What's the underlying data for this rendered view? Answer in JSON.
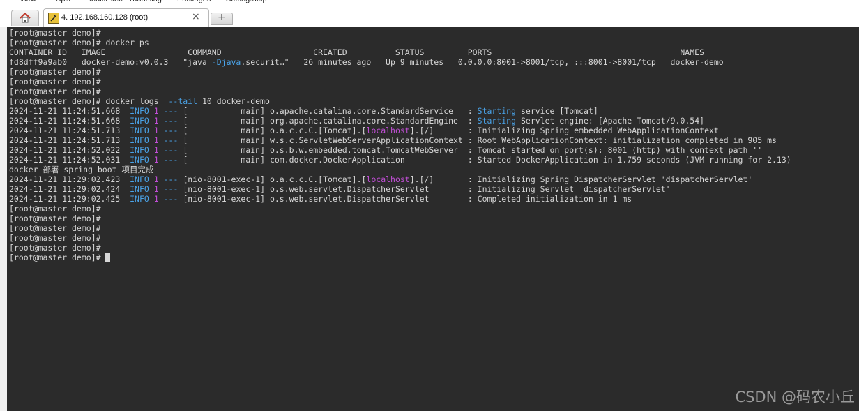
{
  "menu": {
    "items": [
      "View",
      "Split",
      "MultiExec",
      "Tunneling",
      "Packages",
      "Settings",
      "Help"
    ]
  },
  "tabs": {
    "home_icon": "home-icon",
    "active_label": "4. 192.168.160.128 (root)",
    "active_icon": "session-icon",
    "close_glyph": "×",
    "new_tab_glyph": "+"
  },
  "terminal": {
    "lines": [
      [
        {
          "t": "[root@master demo]#"
        }
      ],
      [
        {
          "t": "[root@master demo]# docker ps"
        }
      ],
      [
        {
          "t": "CONTAINER ID   IMAGE                 COMMAND                   CREATED          STATUS         PORTS                                       NAMES"
        }
      ],
      [
        {
          "t": "fd8dff9a9ab0   docker-demo:v0.0.3   \"java "
        },
        {
          "t": "-Djava",
          "c": "blue"
        },
        {
          "t": ".securit…\"   26 minutes ago   Up 9 minutes   0.0.0.0:8001->8001/tcp, :::8001->8001/tcp   docker-demo"
        }
      ],
      [
        {
          "t": "[root@master demo]#"
        }
      ],
      [
        {
          "t": "[root@master demo]#"
        }
      ],
      [
        {
          "t": "[root@master demo]#"
        }
      ],
      [
        {
          "t": "[root@master demo]# docker logs  "
        },
        {
          "t": "--tail",
          "c": "blue"
        },
        {
          "t": " 10 docker-demo"
        }
      ],
      [
        {
          "t": "2024-11-21 11:24:51.668  "
        },
        {
          "t": "INFO",
          "c": "blue"
        },
        {
          "t": " "
        },
        {
          "t": "1",
          "c": "pink"
        },
        {
          "t": " "
        },
        {
          "t": "---",
          "c": "blue"
        },
        {
          "t": " [           main] o.apache.catalina.core.StandardService   : "
        },
        {
          "t": "Starting",
          "c": "blue"
        },
        {
          "t": " service [Tomcat]"
        }
      ],
      [
        {
          "t": "2024-11-21 11:24:51.668  "
        },
        {
          "t": "INFO",
          "c": "blue"
        },
        {
          "t": " "
        },
        {
          "t": "1",
          "c": "pink"
        },
        {
          "t": " "
        },
        {
          "t": "---",
          "c": "blue"
        },
        {
          "t": " [           main] org.apache.catalina.core.StandardEngine  : "
        },
        {
          "t": "Starting",
          "c": "blue"
        },
        {
          "t": " Servlet engine: [Apache Tomcat/9.0.54]"
        }
      ],
      [
        {
          "t": "2024-11-21 11:24:51.713  "
        },
        {
          "t": "INFO",
          "c": "blue"
        },
        {
          "t": " "
        },
        {
          "t": "1",
          "c": "pink"
        },
        {
          "t": " "
        },
        {
          "t": "---",
          "c": "blue"
        },
        {
          "t": " [           main] o.a.c.c.C.[Tomcat].["
        },
        {
          "t": "localhost",
          "c": "pink"
        },
        {
          "t": "].[/]       : Initializing Spring embedded WebApplicationContext"
        }
      ],
      [
        {
          "t": "2024-11-21 11:24:51.713  "
        },
        {
          "t": "INFO",
          "c": "blue"
        },
        {
          "t": " "
        },
        {
          "t": "1",
          "c": "pink"
        },
        {
          "t": " "
        },
        {
          "t": "---",
          "c": "blue"
        },
        {
          "t": " [           main] w.s.c.ServletWebServerApplicationContext : Root WebApplicationContext: initialization completed in 905 ms"
        }
      ],
      [
        {
          "t": "2024-11-21 11:24:52.022  "
        },
        {
          "t": "INFO",
          "c": "blue"
        },
        {
          "t": " "
        },
        {
          "t": "1",
          "c": "pink"
        },
        {
          "t": " "
        },
        {
          "t": "---",
          "c": "blue"
        },
        {
          "t": " [           main] o.s.b.w.embedded.tomcat.TomcatWebServer  : Tomcat started on port(s): 8001 (http) with context path ''"
        }
      ],
      [
        {
          "t": "2024-11-21 11:24:52.031  "
        },
        {
          "t": "INFO",
          "c": "blue"
        },
        {
          "t": " "
        },
        {
          "t": "1",
          "c": "pink"
        },
        {
          "t": " "
        },
        {
          "t": "---",
          "c": "blue"
        },
        {
          "t": " [           main] com.docker.DockerApplication             : Started DockerApplication in 1.759 seconds (JVM running for 2.13)"
        }
      ],
      [
        {
          "t": "docker 部署 spring boot 项目完成"
        }
      ],
      [
        {
          "t": "2024-11-21 11:29:02.423  "
        },
        {
          "t": "INFO",
          "c": "blue"
        },
        {
          "t": " "
        },
        {
          "t": "1",
          "c": "pink"
        },
        {
          "t": " "
        },
        {
          "t": "---",
          "c": "blue"
        },
        {
          "t": " [nio-8001-exec-1] o.a.c.c.C.[Tomcat].["
        },
        {
          "t": "localhost",
          "c": "pink"
        },
        {
          "t": "].[/]       : Initializing Spring DispatcherServlet 'dispatcherServlet'"
        }
      ],
      [
        {
          "t": "2024-11-21 11:29:02.424  "
        },
        {
          "t": "INFO",
          "c": "blue"
        },
        {
          "t": " "
        },
        {
          "t": "1",
          "c": "pink"
        },
        {
          "t": " "
        },
        {
          "t": "---",
          "c": "blue"
        },
        {
          "t": " [nio-8001-exec-1] o.s.web.servlet.DispatcherServlet        : Initializing Servlet 'dispatcherServlet'"
        }
      ],
      [
        {
          "t": "2024-11-21 11:29:02.425  "
        },
        {
          "t": "INFO",
          "c": "blue"
        },
        {
          "t": " "
        },
        {
          "t": "1",
          "c": "pink"
        },
        {
          "t": " "
        },
        {
          "t": "---",
          "c": "blue"
        },
        {
          "t": " [nio-8001-exec-1] o.s.web.servlet.DispatcherServlet        : Completed initialization in 1 ms"
        }
      ],
      [
        {
          "t": "[root@master demo]#"
        }
      ],
      [
        {
          "t": "[root@master demo]#"
        }
      ],
      [
        {
          "t": "[root@master demo]#"
        }
      ],
      [
        {
          "t": "[root@master demo]#"
        }
      ],
      [
        {
          "t": "[root@master demo]#"
        }
      ],
      [
        {
          "t": "[root@master demo]# "
        }
      ]
    ],
    "colors": {
      "background": "#2b2b2b",
      "text": "#d6d6d6",
      "blue": "#4aa3e8",
      "pink": "#c34fd8"
    }
  },
  "watermark": "CSDN @码农小丘"
}
